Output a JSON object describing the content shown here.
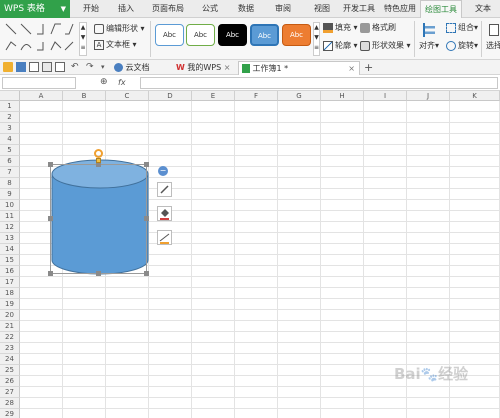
{
  "app": {
    "name": "WPS 表格"
  },
  "menu": {
    "tabs": [
      "开始",
      "插入",
      "页面布局",
      "公式",
      "数据",
      "审阅",
      "视图",
      "开发工具",
      "特色应用",
      "绘图工具",
      "文本"
    ]
  },
  "ribbon": {
    "edit_shape": "编辑形状",
    "text_box": "文本框",
    "style_label": "Abc",
    "fill": "填充",
    "format_painter": "格式刷",
    "outline": "轮廓",
    "shape_effect": "形状效果",
    "align": "对齐",
    "group": "组合",
    "rotate": "旋转",
    "select": "选择"
  },
  "doc_tabs": {
    "cloud": "云文档",
    "my_wps": "我的WPS",
    "workbook": "工作簿1 *"
  },
  "formula": {
    "fx": "fx"
  },
  "sheet": {
    "columns": [
      "A",
      "B",
      "C",
      "D",
      "E",
      "F",
      "G",
      "H",
      "I",
      "J",
      "K"
    ],
    "rows": [
      "1",
      "2",
      "3",
      "4",
      "5",
      "6",
      "7",
      "8",
      "9",
      "10",
      "11",
      "12",
      "13",
      "14",
      "15",
      "16",
      "17",
      "18",
      "19",
      "20",
      "21",
      "22",
      "23",
      "24",
      "25",
      "26",
      "27",
      "28",
      "29"
    ]
  },
  "colors": {
    "accent_green": "#31a14a",
    "shape_fill": "#5b9bd5",
    "shape_stroke": "#41719c",
    "rotate_handle": "#f0a030"
  }
}
